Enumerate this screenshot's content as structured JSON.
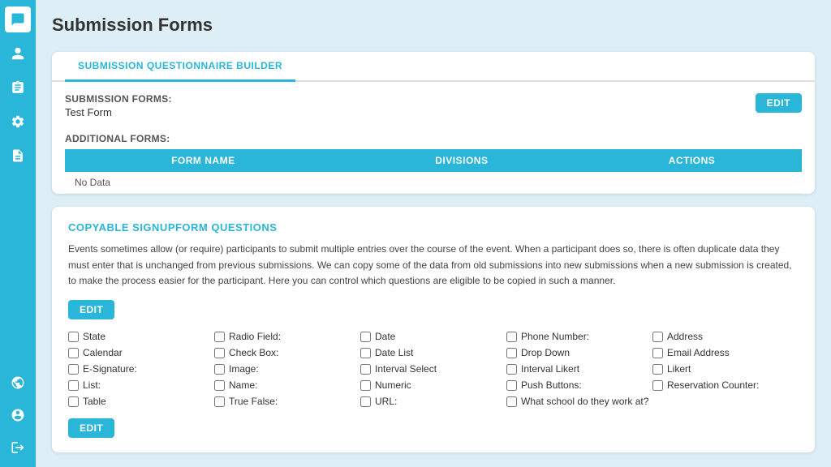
{
  "sidebar": {
    "icons": [
      {
        "name": "chat-icon",
        "symbol": "💬",
        "active": true
      },
      {
        "name": "person-icon",
        "symbol": "👤",
        "active": false
      },
      {
        "name": "clipboard-icon",
        "symbol": "📋",
        "active": false
      },
      {
        "name": "gear-icon",
        "symbol": "⚙️",
        "active": false
      },
      {
        "name": "document-icon",
        "symbol": "📄",
        "active": false
      }
    ],
    "bottom_icons": [
      {
        "name": "globe-icon",
        "symbol": "🌐"
      },
      {
        "name": "user-icon",
        "symbol": "👤"
      },
      {
        "name": "logout-icon",
        "symbol": "➡️"
      }
    ]
  },
  "page": {
    "title": "Submission Forms"
  },
  "card1": {
    "tab_label": "SUBMISSION QUESTIONNAIRE BUILDER",
    "submission_forms_label": "SUBMISSION FORMS:",
    "test_form_value": "Test Form",
    "additional_forms_label": "ADDITIONAL FORMS:",
    "edit_button": "EDIT",
    "table": {
      "columns": [
        "FORM NAME",
        "DIVISIONS",
        "ACTIONS"
      ],
      "rows": [
        {
          "form_name": "No Data",
          "divisions": "",
          "actions": ""
        }
      ]
    }
  },
  "card2": {
    "section_title": "COPYABLE SIGNUPFORM QUESTIONS",
    "description": "Events sometimes allow (or require) participants to submit multiple entries over the course of the event. When a participant does so, there is often duplicate data they must enter that is unchanged from previous submissions. We can copy some of the data from old submissions into new submissions when a new submission is created, to make the process easier for the participant. Here you can control which questions are eligible to be copied in such a manner.",
    "edit_button_top": "EDIT",
    "edit_button_bottom": "EDIT",
    "checkboxes": [
      [
        {
          "label": "State",
          "col": 1
        },
        {
          "label": "Radio Field:",
          "col": 1
        },
        {
          "label": "Date",
          "col": 1
        },
        {
          "label": "Phone Number:",
          "col": 1
        },
        {
          "label": "Address",
          "col": 1
        }
      ],
      [
        {
          "label": "Calendar",
          "col": 2
        },
        {
          "label": "Check Box:",
          "col": 2
        },
        {
          "label": "Date List",
          "col": 2
        },
        {
          "label": "Drop Down",
          "col": 2
        },
        {
          "label": "Email Address",
          "col": 2
        }
      ],
      [
        {
          "label": "E-Signature:",
          "col": 3
        },
        {
          "label": "Image:",
          "col": 3
        },
        {
          "label": "Interval Select",
          "col": 3
        },
        {
          "label": "Interval Likert",
          "col": 3
        },
        {
          "label": "Likert",
          "col": 3
        }
      ],
      [
        {
          "label": "List:",
          "col": 4
        },
        {
          "label": "Name:",
          "col": 4
        },
        {
          "label": "Numeric",
          "col": 4
        },
        {
          "label": "Push Buttons:",
          "col": 4
        },
        {
          "label": "Reservation Counter:",
          "col": 4
        }
      ],
      [
        {
          "label": "Table",
          "col": 5
        },
        {
          "label": "True False:",
          "col": 5
        },
        {
          "label": "URL:",
          "col": 5
        },
        {
          "label": "What school do they work at?",
          "col": 5
        },
        {
          "label": "",
          "col": 5
        }
      ]
    ]
  }
}
